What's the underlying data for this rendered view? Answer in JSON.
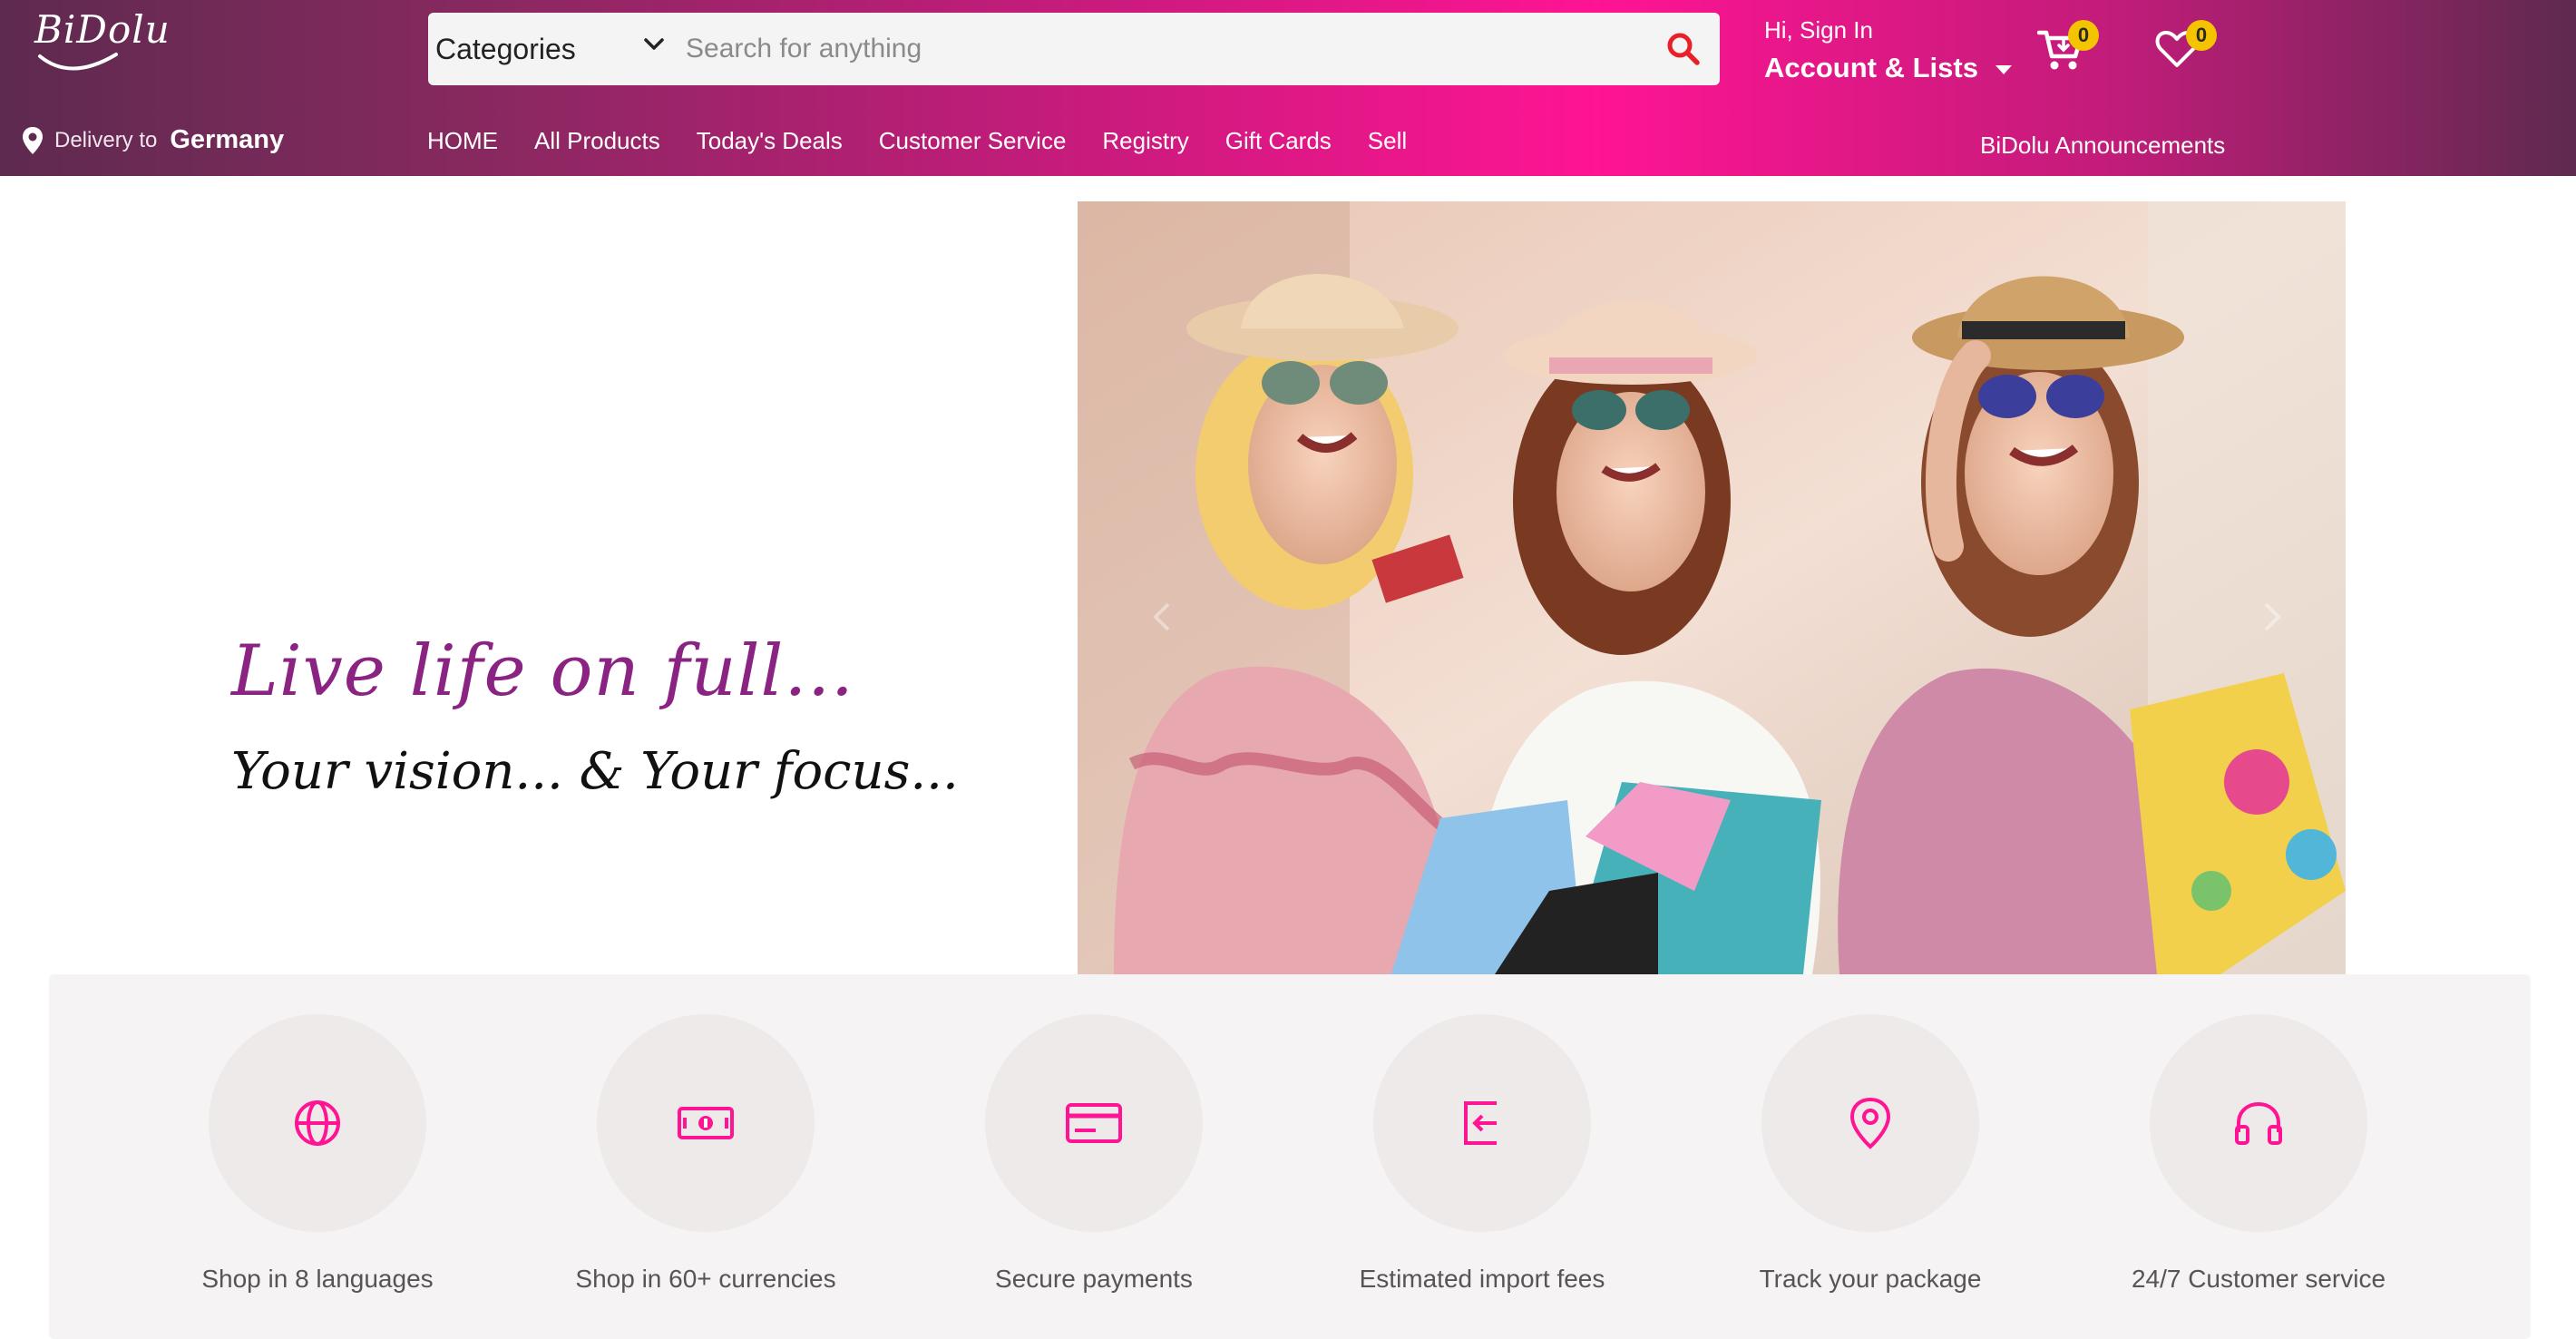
{
  "brand": {
    "logo_text": "BiDolu",
    "accent": "#ff1493",
    "heading_purple": "#8b2382",
    "badge_color": "#f5c400"
  },
  "search": {
    "category_label": "Categories",
    "placeholder": "Search for anything",
    "icon": "search-icon"
  },
  "account": {
    "greeting": "Hi, Sign In",
    "label": "Account & Lists"
  },
  "cart": {
    "count": "0",
    "icon": "cart-icon"
  },
  "wishlist": {
    "count": "0",
    "icon": "heart-icon"
  },
  "delivery": {
    "label": "Delivery to",
    "country": "Germany"
  },
  "nav": {
    "items": [
      {
        "label": "HOME"
      },
      {
        "label": "All Products"
      },
      {
        "label": "Today's Deals"
      },
      {
        "label": "Customer Service"
      },
      {
        "label": "Registry"
      },
      {
        "label": "Gift Cards"
      },
      {
        "label": "Sell"
      }
    ],
    "announcements": "BiDolu Announcements"
  },
  "hero": {
    "tagline": "Live life on full...",
    "subtagline": "Your vision... & Your focus..."
  },
  "features": [
    {
      "label": "Shop in 8 languages",
      "icon": "globe-icon"
    },
    {
      "label": "Shop in 60+ currencies",
      "icon": "banknote-icon"
    },
    {
      "label": "Secure payments",
      "icon": "credit-card-icon"
    },
    {
      "label": "Estimated import fees",
      "icon": "import-icon"
    },
    {
      "label": "Track your package",
      "icon": "location-pin-icon"
    },
    {
      "label": "24/7 Customer service",
      "icon": "headphones-icon"
    }
  ]
}
